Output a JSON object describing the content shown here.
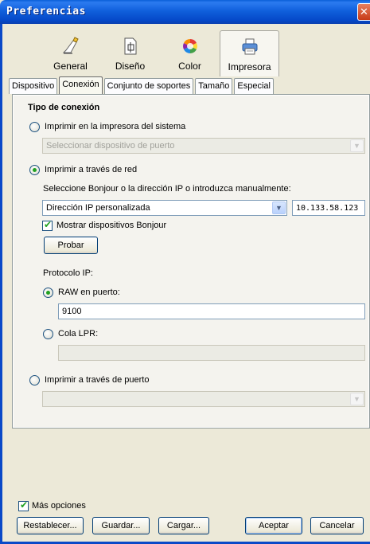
{
  "window": {
    "title": "Preferencias",
    "close_glyph": "✕"
  },
  "toolbar": [
    {
      "label": "General",
      "icon": "pencil-icon",
      "active": false
    },
    {
      "label": "Diseño",
      "icon": "layout-icon",
      "active": false
    },
    {
      "label": "Color",
      "icon": "color-wheel-icon",
      "active": false
    },
    {
      "label": "Impresora",
      "icon": "printer-icon",
      "active": true
    }
  ],
  "tabs": [
    "Dispositivo",
    "Conexión",
    "Conjunto de soportes",
    "Tamaño",
    "Especial"
  ],
  "active_tab": "Conexión",
  "connection": {
    "section_title": "Tipo de conexión",
    "system_printer": {
      "label": "Imprimir en la impresora del sistema",
      "checked": false,
      "select_placeholder": "Seleccionar dispositivo de puerto"
    },
    "network": {
      "label": "Imprimir a través de red",
      "checked": true,
      "instruction": "Seleccione Bonjour o la dirección IP o introduzca manualmente:",
      "ip_select_value": "Dirección IP personalizada",
      "ip_address": "10.133.58.123",
      "show_bonjour_label": "Mostrar dispositivos Bonjour",
      "show_bonjour_checked": true,
      "test_button": "Probar",
      "protocol_label": "Protocolo IP:",
      "raw_label": "RAW en puerto:",
      "raw_checked": true,
      "raw_port": "9100",
      "lpr_label": "Cola LPR:",
      "lpr_checked": false,
      "lpr_value": ""
    },
    "port": {
      "label": "Imprimir a través de puerto",
      "checked": false,
      "select_value": ""
    }
  },
  "footer": {
    "more_options_label": "Más opciones",
    "more_options_checked": true,
    "buttons": {
      "reset": "Restablecer...",
      "save": "Guardar...",
      "load": "Cargar...",
      "accept": "Aceptar",
      "cancel": "Cancelar"
    }
  },
  "colors": {
    "titlebar": "#0a5fd8",
    "face": "#ece9d8",
    "accent_check": "#21a121"
  }
}
